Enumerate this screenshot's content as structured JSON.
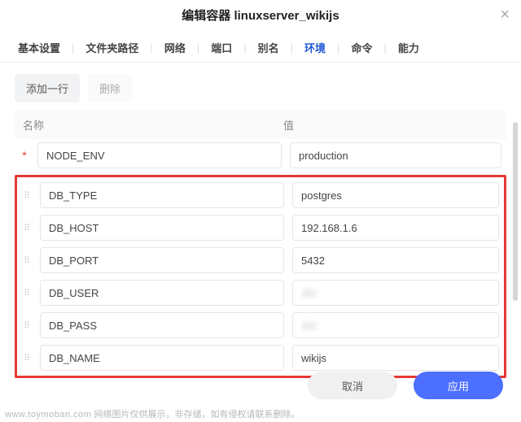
{
  "header": {
    "title": "编辑容器 linuxserver_wikijs",
    "close": "×"
  },
  "tabs": {
    "items": [
      "基本设置",
      "文件夹路径",
      "网络",
      "端口",
      "别名",
      "环境",
      "命令",
      "能力"
    ],
    "active_index": 5
  },
  "toolbar": {
    "add_row": "添加一行",
    "delete": "删除"
  },
  "table": {
    "header_name": "名称",
    "header_value": "值",
    "rows": [
      {
        "name": "NODE_ENV",
        "value": "production",
        "required": true,
        "masked": false,
        "highlight": false
      },
      {
        "name": "DB_TYPE",
        "value": "postgres",
        "required": false,
        "masked": false,
        "highlight": true
      },
      {
        "name": "DB_HOST",
        "value": "192.168.1.6",
        "required": false,
        "masked": false,
        "highlight": true
      },
      {
        "name": "DB_PORT",
        "value": "5432",
        "required": false,
        "masked": false,
        "highlight": true
      },
      {
        "name": "DB_USER",
        "value": "",
        "required": false,
        "masked": true,
        "highlight": true
      },
      {
        "name": "DB_PASS",
        "value": "",
        "required": false,
        "masked": true,
        "highlight": true
      },
      {
        "name": "DB_NAME",
        "value": "wikijs",
        "required": false,
        "masked": false,
        "highlight": true
      }
    ]
  },
  "footer": {
    "cancel": "取消",
    "apply": "应用"
  },
  "watermark": {
    "host": "www.toymoban.com",
    "text": "网络图片仅供展示，非存储，如有侵权请联系删除。"
  }
}
